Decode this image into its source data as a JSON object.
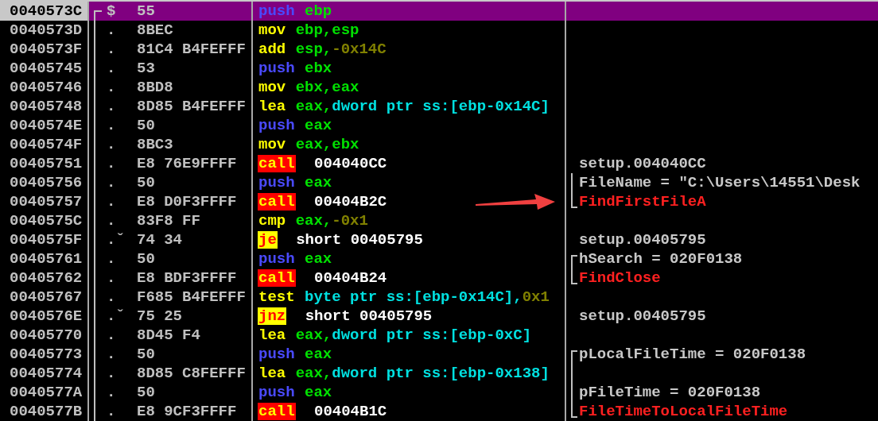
{
  "rows": [
    {
      "address": "0040573C",
      "marker": "$",
      "bytes": "55",
      "selected": true,
      "mnemonic": "push",
      "kind": "push",
      "operands": [
        {
          "text": "ebp",
          "kind": "reg"
        }
      ]
    },
    {
      "address": "0040573D",
      "marker": ".",
      "bytes": "8BEC",
      "selected": false,
      "mnemonic": "mov",
      "kind": "plain",
      "operands": [
        {
          "text": "ebp,esp",
          "kind": "reg"
        }
      ]
    },
    {
      "address": "0040573F",
      "marker": ".",
      "bytes": "81C4 B4FEFFF",
      "selected": false,
      "mnemonic": "add",
      "kind": "plain",
      "operands": [
        {
          "text": "esp,",
          "kind": "reg"
        },
        {
          "text": "-0x14C",
          "kind": "const"
        }
      ]
    },
    {
      "address": "00405745",
      "marker": ".",
      "bytes": "53",
      "selected": false,
      "mnemonic": "push",
      "kind": "push",
      "operands": [
        {
          "text": "ebx",
          "kind": "reg"
        }
      ]
    },
    {
      "address": "00405746",
      "marker": ".",
      "bytes": "8BD8",
      "selected": false,
      "mnemonic": "mov",
      "kind": "plain",
      "operands": [
        {
          "text": "ebx,eax",
          "kind": "reg"
        }
      ]
    },
    {
      "address": "00405748",
      "marker": ".",
      "bytes": "8D85 B4FEFFF",
      "selected": false,
      "mnemonic": "lea",
      "kind": "plain",
      "operands": [
        {
          "text": "eax,",
          "kind": "reg"
        },
        {
          "text": "dword ptr ss:[ebp-0x14C]",
          "kind": "mem"
        }
      ]
    },
    {
      "address": "0040574E",
      "marker": ".",
      "bytes": "50",
      "selected": false,
      "mnemonic": "push",
      "kind": "push",
      "operands": [
        {
          "text": "eax",
          "kind": "reg"
        }
      ]
    },
    {
      "address": "0040574F",
      "marker": ".",
      "bytes": "8BC3",
      "selected": false,
      "mnemonic": "mov",
      "kind": "plain",
      "operands": [
        {
          "text": "eax,ebx",
          "kind": "reg"
        }
      ]
    },
    {
      "address": "00405751",
      "marker": ".",
      "bytes": "E8 76E9FFFF",
      "selected": false,
      "mnemonic": "call",
      "kind": "call",
      "operands": [
        {
          "text": "004040CC",
          "kind": "addr"
        }
      ],
      "comment": {
        "text": "setup.004040CC",
        "kind": "plain"
      }
    },
    {
      "address": "00405756",
      "marker": ".",
      "bytes": "50",
      "selected": false,
      "mnemonic": "push",
      "kind": "push",
      "operands": [
        {
          "text": "eax",
          "kind": "reg"
        }
      ],
      "comment": {
        "text": "FileName = \"C:\\Users\\14551\\Desk",
        "kind": "plain",
        "bracket": {
          "kind": "mid"
        }
      }
    },
    {
      "address": "00405757",
      "marker": ".",
      "bytes": "E8 D0F3FFFF",
      "selected": false,
      "mnemonic": "call",
      "kind": "call",
      "operands": [
        {
          "text": "00404B2C",
          "kind": "addr"
        }
      ],
      "comment": {
        "text": "FindFirstFileA",
        "kind": "api",
        "bracket": {
          "kind": "bottom"
        }
      }
    },
    {
      "address": "0040575C",
      "marker": ".",
      "bytes": "83F8 FF",
      "selected": false,
      "mnemonic": "cmp",
      "kind": "plain",
      "operands": [
        {
          "text": "eax,",
          "kind": "reg"
        },
        {
          "text": "-0x1",
          "kind": "const"
        }
      ]
    },
    {
      "address": "0040575F",
      "marker": ".ˇ",
      "bytes": "74 34",
      "selected": false,
      "mnemonic": "je",
      "kind": "jump",
      "operands": [
        {
          "text": "short 00405795",
          "kind": "addr"
        }
      ],
      "comment": {
        "text": "setup.00405795",
        "kind": "plain"
      }
    },
    {
      "address": "00405761",
      "marker": ".",
      "bytes": "50",
      "selected": false,
      "mnemonic": "push",
      "kind": "push",
      "operands": [
        {
          "text": "eax",
          "kind": "reg"
        }
      ],
      "comment": {
        "text": "hSearch = 020F0138",
        "kind": "plain",
        "bracket": {
          "kind": "top"
        }
      }
    },
    {
      "address": "00405762",
      "marker": ".",
      "bytes": "E8 BDF3FFFF",
      "selected": false,
      "mnemonic": "call",
      "kind": "call",
      "operands": [
        {
          "text": "00404B24",
          "kind": "addr"
        }
      ],
      "comment": {
        "text": "FindClose",
        "kind": "api",
        "bracket": {
          "kind": "bottom"
        }
      }
    },
    {
      "address": "00405767",
      "marker": ".",
      "bytes": "F685 B4FEFFF",
      "selected": false,
      "mnemonic": "test",
      "kind": "plain",
      "operands": [
        {
          "text": "byte ptr ss:[ebp-0x14C],",
          "kind": "mem"
        },
        {
          "text": "0x1",
          "kind": "const"
        }
      ]
    },
    {
      "address": "0040576E",
      "marker": ".ˇ",
      "bytes": "75 25",
      "selected": false,
      "mnemonic": "jnz",
      "kind": "jump",
      "operands": [
        {
          "text": "short 00405795",
          "kind": "addr"
        }
      ],
      "comment": {
        "text": "setup.00405795",
        "kind": "plain"
      }
    },
    {
      "address": "00405770",
      "marker": ".",
      "bytes": "8D45 F4",
      "selected": false,
      "mnemonic": "lea",
      "kind": "plain",
      "operands": [
        {
          "text": "eax,",
          "kind": "reg"
        },
        {
          "text": "dword ptr ss:[ebp-0xC]",
          "kind": "mem"
        }
      ]
    },
    {
      "address": "00405773",
      "marker": ".",
      "bytes": "50",
      "selected": false,
      "mnemonic": "push",
      "kind": "push",
      "operands": [
        {
          "text": "eax",
          "kind": "reg"
        }
      ],
      "comment": {
        "text": "pLocalFileTime = 020F0138",
        "kind": "plain",
        "bracket": {
          "kind": "top"
        }
      }
    },
    {
      "address": "00405774",
      "marker": ".",
      "bytes": "8D85 C8FEFFF",
      "selected": false,
      "mnemonic": "lea",
      "kind": "plain",
      "operands": [
        {
          "text": "eax,",
          "kind": "reg"
        },
        {
          "text": "dword ptr ss:[ebp-0x138]",
          "kind": "mem"
        }
      ],
      "comment": {
        "bracket": {
          "kind": "mid"
        }
      }
    },
    {
      "address": "0040577A",
      "marker": ".",
      "bytes": "50",
      "selected": false,
      "mnemonic": "push",
      "kind": "push",
      "operands": [
        {
          "text": "eax",
          "kind": "reg"
        }
      ],
      "comment": {
        "text": "pFileTime = 020F0138",
        "kind": "plain",
        "bracket": {
          "kind": "mid"
        }
      }
    },
    {
      "address": "0040577B",
      "marker": ".",
      "bytes": "E8 9CF3FFFF",
      "selected": false,
      "mnemonic": "call",
      "kind": "call",
      "operands": [
        {
          "text": "00404B1C",
          "kind": "addr"
        }
      ],
      "comment": {
        "text": "FileTimeToLocalFileTime",
        "kind": "api",
        "bracket": {
          "kind": "bottom"
        }
      }
    }
  ]
}
